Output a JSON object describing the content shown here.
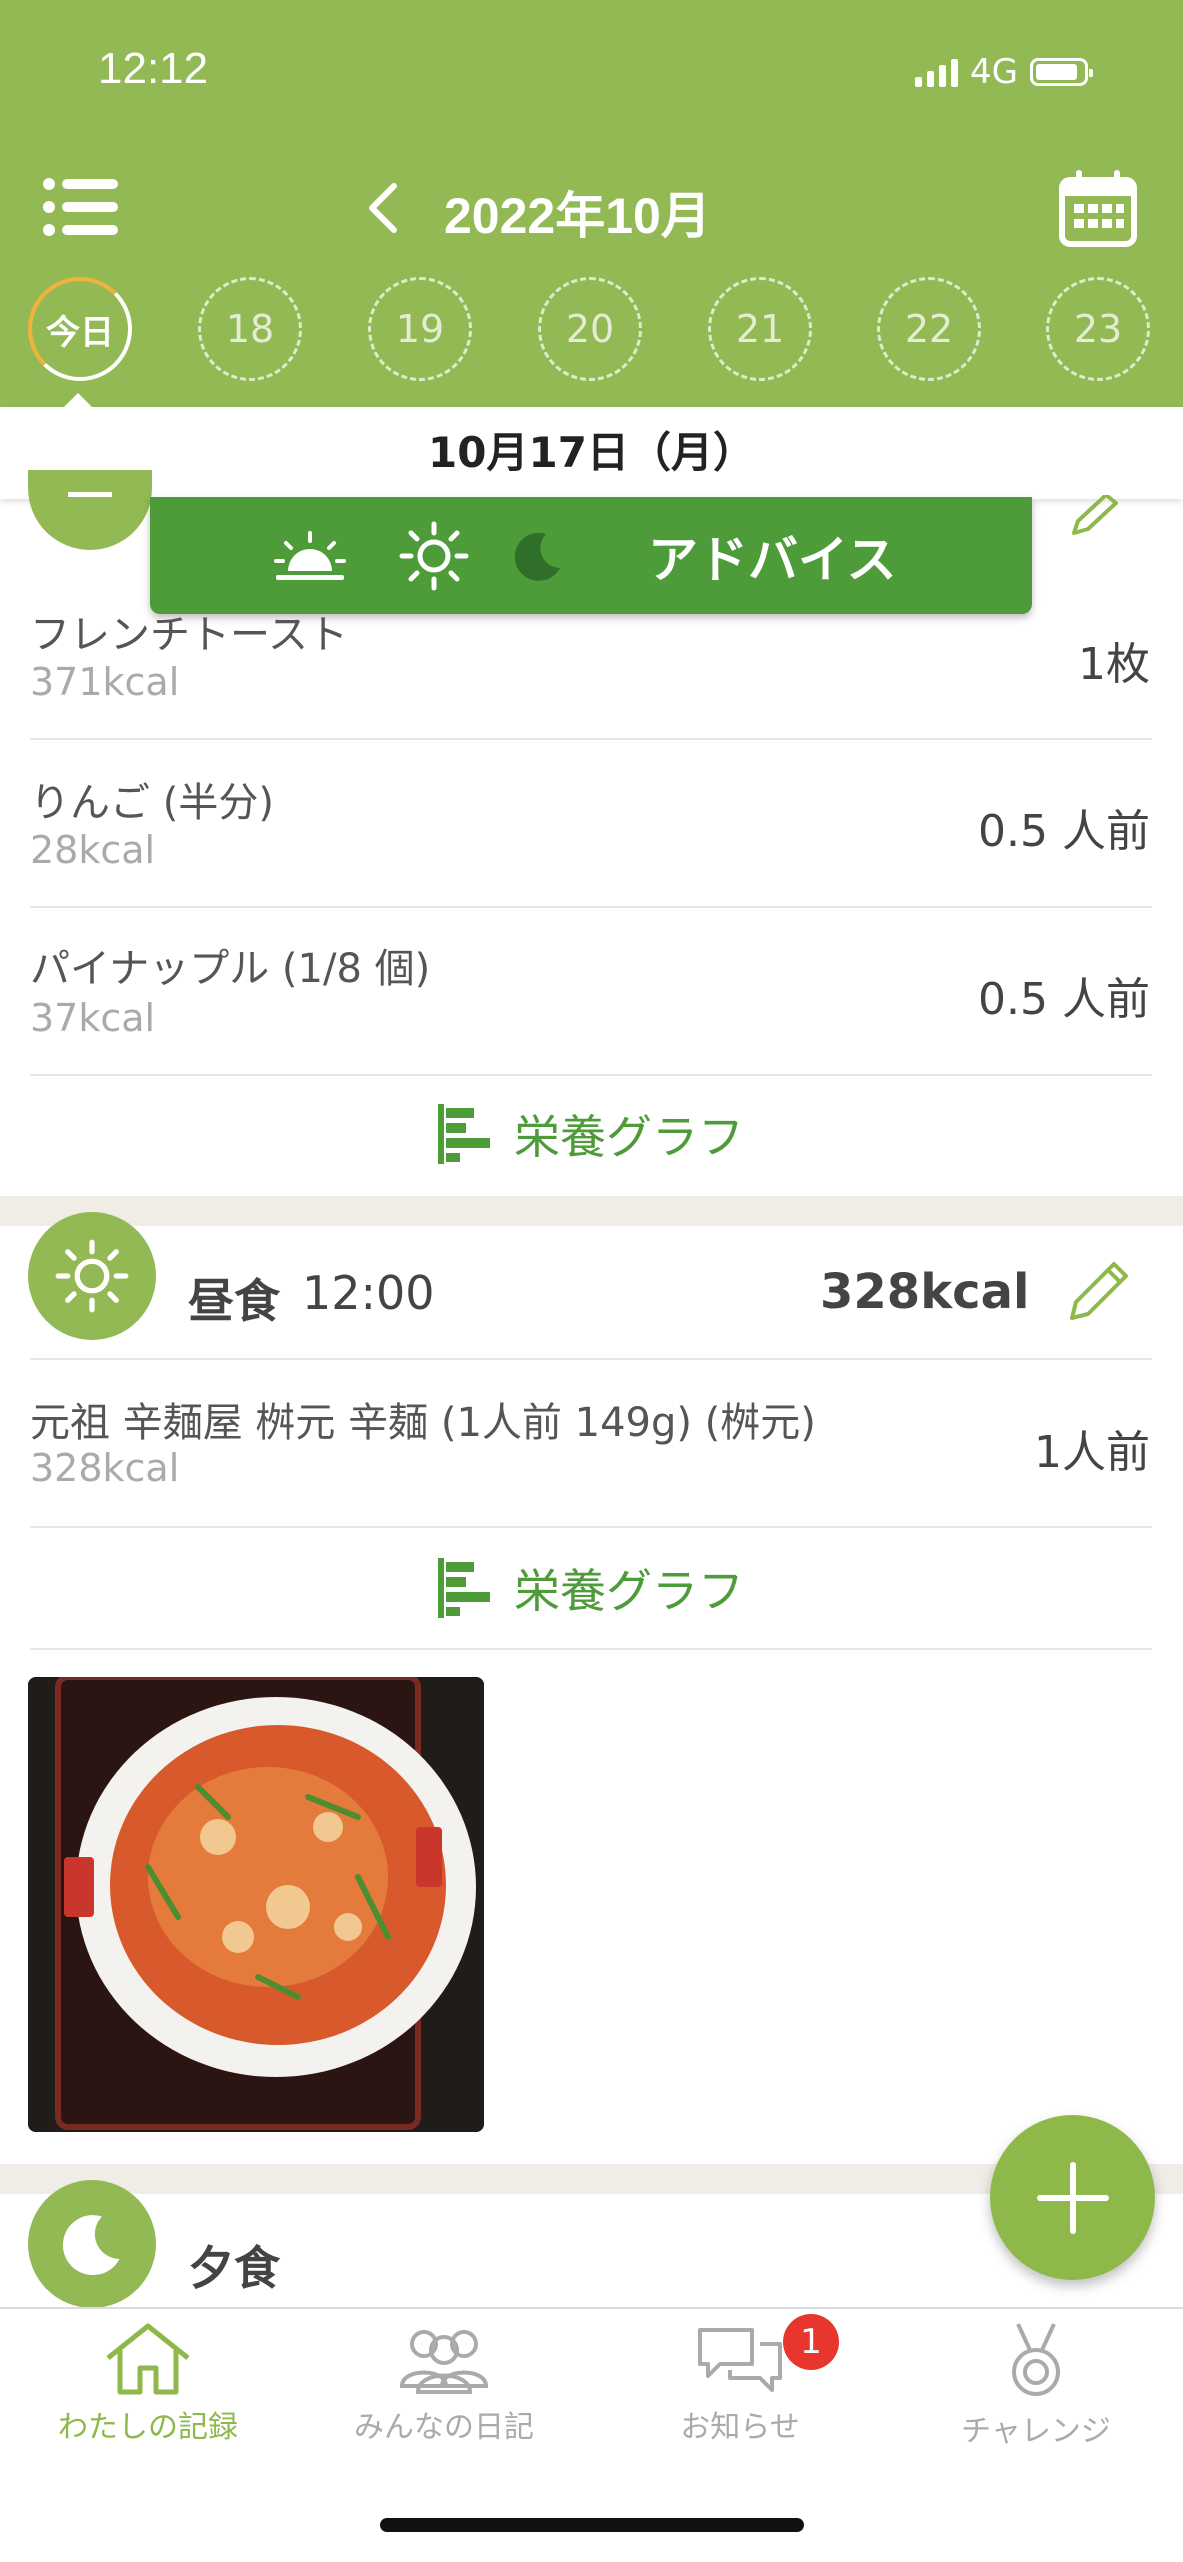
{
  "status_bar": {
    "time": "12:12",
    "network": "4G"
  },
  "header": {
    "month_title": "2022年10月",
    "days": [
      "今日",
      "18",
      "19",
      "20",
      "21",
      "22",
      "23"
    ]
  },
  "date_bar": {
    "label": "10月17日（月）"
  },
  "advice": {
    "label": "アドバイス"
  },
  "breakfast": {
    "items": [
      {
        "name": "フレンチトースト",
        "kcal": "371kcal",
        "qty": "1枚"
      },
      {
        "name": "りんご (半分)",
        "kcal": "28kcal",
        "qty": "0.5 人前"
      },
      {
        "name": "パイナップル (1/8 個)",
        "kcal": "37kcal",
        "qty": "0.5 人前"
      }
    ],
    "graph_label": "栄養グラフ"
  },
  "lunch": {
    "title": "昼食",
    "time": "12:00",
    "kcal": "328kcal",
    "items": [
      {
        "name": "元祖 辛麺屋 桝元 辛麺 (1人前 149g) (桝元)",
        "kcal": "328kcal",
        "qty": "1人前"
      }
    ],
    "graph_label": "栄養グラフ"
  },
  "dinner": {
    "title": "夕食"
  },
  "tabbar": {
    "tabs": [
      {
        "label": "わたしの記録",
        "icon": "home-icon",
        "active": true
      },
      {
        "label": "みんなの日記",
        "icon": "people-icon",
        "active": false
      },
      {
        "label": "お知らせ",
        "icon": "chat-bubbles-icon",
        "active": false
      },
      {
        "label": "チャレンジ",
        "icon": "medal-icon",
        "active": false
      }
    ],
    "notification_badge": "1"
  },
  "colors": {
    "header_green": "#93b955",
    "accent_green": "#4e9b39",
    "badge_red": "#e8362f"
  }
}
